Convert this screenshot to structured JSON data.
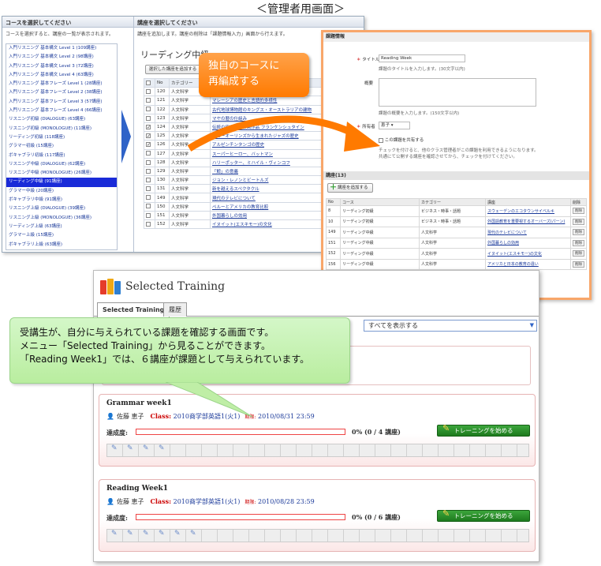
{
  "caption": "＜管理者用画面＞",
  "course_panel": {
    "title": "コースを選択してください",
    "desc": "コースを選択すると、講座の一覧が表示されます。",
    "items": [
      "入門リスニング 基本構文 Level 1 (109講座)",
      "入門リスニング 基本構文 Level 2 (98講座)",
      "入門リスニング 基本構文 Level 3 (72講座)",
      "入門リスニング 基本構文 Level 4 (63講座)",
      "入門リスニング 基本フレーズ Level 1 (28講座)",
      "入門リスニング 基本フレーズ Level 2 (38講座)",
      "入門リスニング 基本フレーズ Level 3 (57講座)",
      "入門リスニング 基本フレーズ Level 4 (66講座)",
      "リスニング初級 (DIALOGUE) (63講座)",
      "リスニング初級 (MONOLOGUE) (11講座)",
      "リーディング初級 (118講座)",
      "グラマー初級 (15講座)",
      "ボキャブラリ初級 (117講座)",
      "リスニング中級 (DIALOGUE) (62講座)",
      "リスニング中級 (MONOLOGUE) (26講座)",
      "リーディング中級 (91講座)",
      "グラマー中級 (20講座)",
      "ボキャブラリ中級 (91講座)",
      "リスニング上級 (DIALOGUE) (39講座)",
      "リスニング上級 (MONOLOGUE) (36講座)",
      "リーディング上級 (63講座)",
      "グラマー上級 (15講座)",
      "ボキャブラリ上級 (63講座)"
    ],
    "selected_index": 15
  },
  "lecture_panel": {
    "title": "講座を選択してください",
    "desc": "講座を追加します。講座の削除は「課題情報入力」画面から行えます。",
    "course_title": "リーディング中級",
    "add_button": "選択した講座を追加する",
    "columns": [
      "",
      "No",
      "カテゴリー",
      ""
    ],
    "rows": [
      {
        "no": "120",
        "cat": "人文科学",
        "name": "",
        "checked": false
      },
      {
        "no": "121",
        "cat": "人文科学",
        "name": "マレーシアの歴史と言語的多様性",
        "checked": false
      },
      {
        "no": "122",
        "cat": "人文科学",
        "name": "古代地球博物館のキングス・オーストラリアの建物",
        "checked": false
      },
      {
        "no": "123",
        "cat": "人文科学",
        "name": "マヤの暦の仕組み",
        "checked": false
      },
      {
        "no": "124",
        "cat": "人文科学",
        "name": "伝統の街歩き、映画作品 フランケンシュタイン",
        "checked": true
      },
      {
        "no": "125",
        "cat": "人文科学",
        "name": "ニューオーリンズから生まれたジャズの歴史",
        "checked": true
      },
      {
        "no": "126",
        "cat": "人文科学",
        "name": "アルゼンチンタンゴの歴史",
        "checked": true
      },
      {
        "no": "127",
        "cat": "人文科学",
        "name": "スーパーヒーロー、バットマン",
        "checked": false
      },
      {
        "no": "128",
        "cat": "人文科学",
        "name": "ハリーポッター、ミハイル・ヴィンコフ",
        "checked": false
      },
      {
        "no": "129",
        "cat": "人文科学",
        "name": "「鯨」の意義",
        "checked": false
      },
      {
        "no": "130",
        "cat": "人文科学",
        "name": "ジョン・レノンとビートルズ",
        "checked": false
      },
      {
        "no": "131",
        "cat": "人文科学",
        "name": "新を越えるスペクタクル",
        "checked": false
      },
      {
        "no": "149",
        "cat": "人文科学",
        "name": "現代のテレビについて",
        "checked": false
      },
      {
        "no": "150",
        "cat": "人文科学",
        "name": "ペルーとアメリカの教育比較",
        "checked": false
      },
      {
        "no": "151",
        "cat": "人文科学",
        "name": "外国暮らしの効用",
        "checked": false
      },
      {
        "no": "152",
        "cat": "人文科学",
        "name": "イヌイット(エスキモー)の文化",
        "checked": false
      }
    ]
  },
  "orange_note": {
    "line1": "独自のコースに",
    "line2": "再編成する"
  },
  "task_window": {
    "section_title": "課題情報",
    "title_label": "タイトル",
    "title_value": "Reading Week",
    "title_hint": "課題のタイトルを入力します。(30文字以内)",
    "summary_label": "概要",
    "summary_hint": "課題の概要を入力します。(150文字以内)",
    "owner_label": "所有者",
    "owner_value": "恵子",
    "share_label": "この課題を共有する",
    "share_hint1": "チェックを付けると、他のクラス管理者がこの課題を利用できるようになります。",
    "share_hint2": "共通にて公開する講座を確認させてから、チェックを付けてください。",
    "lectures_head": "講座(13)",
    "add_button": "講座を追加する",
    "columns": [
      "No",
      "コース",
      "カテゴリー",
      "講座",
      "削除"
    ],
    "rows": [
      {
        "no": "8",
        "course": "リーディング初級",
        "cat": "ビジネス・時事・話題",
        "name": "スウェーデンのエコタウンサイベルキ",
        "del": "削除"
      },
      {
        "no": "10",
        "course": "リーディング初級",
        "cat": "ビジネス・時事・話題",
        "name": "外国語教育を重要視するオーバーズ(パーン)",
        "del": "削除"
      },
      {
        "no": "149",
        "course": "リーディング中級",
        "cat": "人文科学",
        "name": "現代のテレビについて",
        "del": "削除"
      },
      {
        "no": "151",
        "course": "リーディング中級",
        "cat": "人文科学",
        "name": "外国暮らしの効用",
        "del": "削除"
      },
      {
        "no": "152",
        "course": "リーディング中級",
        "cat": "人文科学",
        "name": "イヌイット(エスキモー)の文化",
        "del": "削除"
      },
      {
        "no": "156",
        "course": "リーディング中級",
        "cat": "人文科学",
        "name": "アメリカと日本の教育の違い",
        "del": "削除"
      }
    ]
  },
  "training": {
    "app_title": "Selected Training",
    "tab_active": "Selected Training",
    "tab_history": "履歴",
    "filter": "すべてを表示する",
    "cards": [
      {
        "title": "Grammar week1",
        "user": "佐藤 恵子",
        "class_label": "Class:",
        "class_value": "2010商学部英語1(火1)",
        "due_label": "期限:",
        "due_value": "2010/08/31 23:59",
        "progress_label": "達成度:",
        "progress_text": "0% (0 / 4 講座)",
        "progress": 0,
        "button": "トレーニングを始める",
        "slots_filled": 4
      },
      {
        "title": "Reading Week1",
        "user": "佐藤 恵子",
        "class_label": "Class:",
        "class_value": "2010商学部英語1(火1)",
        "due_label": "期限:",
        "due_value": "2010/08/28 23:59",
        "progress_label": "達成度:",
        "progress_text": "0% (0 / 6 講座)",
        "progress": 0,
        "button": "トレーニングを始める",
        "slots_filled": 6
      }
    ]
  },
  "green_note": {
    "line1": "受講生が、自分に与えられている課題を確認する画面です。",
    "line2": "メニュー「Selected Training」から見ることができます。",
    "line3": "「Reading Week1」では、６講座が課題として与えられています。"
  },
  "colors": {
    "accent_orange": "#ff7a00",
    "selected_blue": "#1a2bd8",
    "start_green": "#1d7a1d",
    "note_green": "#c8f2b3"
  }
}
